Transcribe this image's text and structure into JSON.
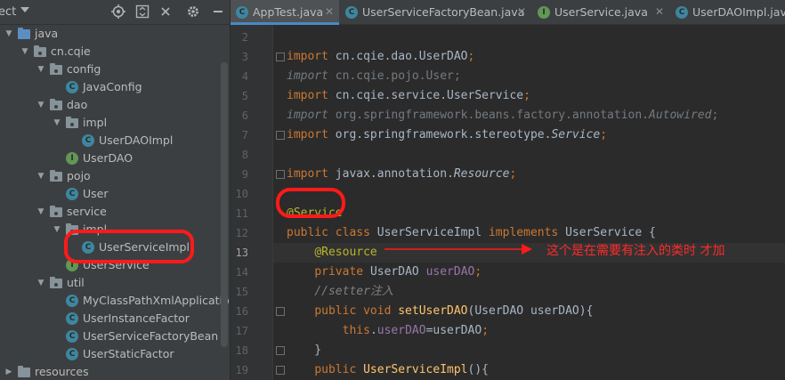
{
  "project": {
    "title": "ect",
    "header_icons": [
      "crosshair-icon",
      "expand-all-icon",
      "collapse-all-icon",
      "gear-icon",
      "hide-icon"
    ],
    "tree": [
      {
        "label": "java",
        "type": "folder-blue",
        "depth": 0,
        "expanded": true
      },
      {
        "label": "cn.cqie",
        "type": "package",
        "depth": 1,
        "expanded": true
      },
      {
        "label": "config",
        "type": "package",
        "depth": 2,
        "expanded": true
      },
      {
        "label": "JavaConfig",
        "type": "class",
        "depth": 3
      },
      {
        "label": "dao",
        "type": "package",
        "depth": 2,
        "expanded": true
      },
      {
        "label": "impl",
        "type": "package",
        "depth": 3,
        "expanded": true
      },
      {
        "label": "UserDAOImpl",
        "type": "class",
        "depth": 4
      },
      {
        "label": "UserDAO",
        "type": "interface",
        "depth": 3
      },
      {
        "label": "pojo",
        "type": "package",
        "depth": 2,
        "expanded": true
      },
      {
        "label": "User",
        "type": "class",
        "depth": 3
      },
      {
        "label": "service",
        "type": "package",
        "depth": 2,
        "expanded": true
      },
      {
        "label": "impl",
        "type": "package",
        "depth": 3,
        "expanded": true
      },
      {
        "label": "UserServiceImpl",
        "type": "class",
        "depth": 4,
        "selected": true
      },
      {
        "label": "UserService",
        "type": "interface",
        "depth": 3
      },
      {
        "label": "util",
        "type": "package",
        "depth": 2,
        "expanded": true
      },
      {
        "label": "MyClassPathXmlApplicationC",
        "type": "class",
        "depth": 3
      },
      {
        "label": "UserInstanceFactor",
        "type": "class",
        "depth": 3
      },
      {
        "label": "UserServiceFactoryBean",
        "type": "class",
        "depth": 3
      },
      {
        "label": "UserStaticFactor",
        "type": "class",
        "depth": 3
      },
      {
        "label": "resources",
        "type": "folder",
        "depth": 0,
        "expanded": false
      }
    ]
  },
  "tabs": [
    {
      "label": "AppTest.java",
      "icon": "class-test",
      "active": true,
      "closable": true
    },
    {
      "label": "UserServiceFactoryBean.java",
      "icon": "class",
      "closable": true
    },
    {
      "label": "UserService.java",
      "icon": "interface",
      "closable": true
    },
    {
      "label": "UserDAOImpl.java",
      "icon": "class",
      "closable": false
    }
  ],
  "editor": {
    "current_line": 13,
    "lines": [
      {
        "n": 2,
        "tokens": []
      },
      {
        "n": 3,
        "fold": true,
        "tokens": [
          [
            "kw",
            "import "
          ],
          [
            "plain",
            "cn.cqie.dao.UserDAO"
          ],
          [
            "kw",
            ";"
          ]
        ]
      },
      {
        "n": 4,
        "tokens": [
          [
            "dim-i",
            "import "
          ],
          [
            "dim",
            "cn.cqie.pojo.User;"
          ]
        ]
      },
      {
        "n": 5,
        "tokens": [
          [
            "kw",
            "import "
          ],
          [
            "plain",
            "cn.cqie.service.UserService"
          ],
          [
            "kw",
            ";"
          ]
        ]
      },
      {
        "n": 6,
        "tokens": [
          [
            "dim-i",
            "import "
          ],
          [
            "dim",
            "org.springframework.beans.factory.annotation."
          ],
          [
            "dim-i",
            "Autowired"
          ],
          [
            "dim",
            ";"
          ]
        ]
      },
      {
        "n": 7,
        "fold": true,
        "tokens": [
          [
            "kw",
            "import "
          ],
          [
            "plain",
            "org.springframework.stereotype."
          ],
          [
            "it",
            "Service"
          ],
          [
            "kw",
            ";"
          ]
        ]
      },
      {
        "n": 8,
        "tokens": []
      },
      {
        "n": 9,
        "fold": true,
        "tokens": [
          [
            "kw",
            "import "
          ],
          [
            "plain",
            "javax.annotation."
          ],
          [
            "it",
            "Resource"
          ],
          [
            "kw",
            ";"
          ]
        ]
      },
      {
        "n": 10,
        "tokens": []
      },
      {
        "n": 11,
        "tokens": [
          [
            "ann",
            "@Service"
          ]
        ]
      },
      {
        "n": 12,
        "tokens": [
          [
            "kw",
            "public class "
          ],
          [
            "plain",
            "UserServiceImpl "
          ],
          [
            "kw",
            "implements "
          ],
          [
            "plain",
            "UserService {"
          ]
        ]
      },
      {
        "n": 13,
        "tokens": [
          [
            "plain",
            "    "
          ],
          [
            "ann",
            "@Resource"
          ]
        ]
      },
      {
        "n": 14,
        "tokens": [
          [
            "plain",
            "    "
          ],
          [
            "kw",
            "private "
          ],
          [
            "plain",
            "UserDAO "
          ],
          [
            "fld",
            "userDAO"
          ],
          [
            "kw",
            ";"
          ]
        ]
      },
      {
        "n": 15,
        "tokens": [
          [
            "plain",
            "    "
          ],
          [
            "cmt",
            "//setter注入"
          ]
        ]
      },
      {
        "n": 16,
        "fold": true,
        "tokens": [
          [
            "plain",
            "    "
          ],
          [
            "kw",
            "public void "
          ],
          [
            "fn",
            "setUserDAO"
          ],
          [
            "plain",
            "(UserDAO userDAO){"
          ]
        ]
      },
      {
        "n": 17,
        "tokens": [
          [
            "plain",
            "        "
          ],
          [
            "kw",
            "this"
          ],
          [
            "plain",
            "."
          ],
          [
            "fld",
            "userDAO"
          ],
          [
            "plain",
            "=userDAO"
          ],
          [
            "kw",
            ";"
          ]
        ]
      },
      {
        "n": 18,
        "fold": true,
        "tokens": [
          [
            "plain",
            "    }"
          ]
        ]
      },
      {
        "n": 19,
        "fold": true,
        "tokens": [
          [
            "plain",
            "    "
          ],
          [
            "kw",
            "public "
          ],
          [
            "fn",
            "UserServiceImpl"
          ],
          [
            "plain",
            "(){"
          ]
        ]
      }
    ]
  },
  "annotation_note": "这个是在需要有注入的类时 才加",
  "colors": {
    "accent": "#4a88c7",
    "annotation_red": "#ff1a1a"
  }
}
